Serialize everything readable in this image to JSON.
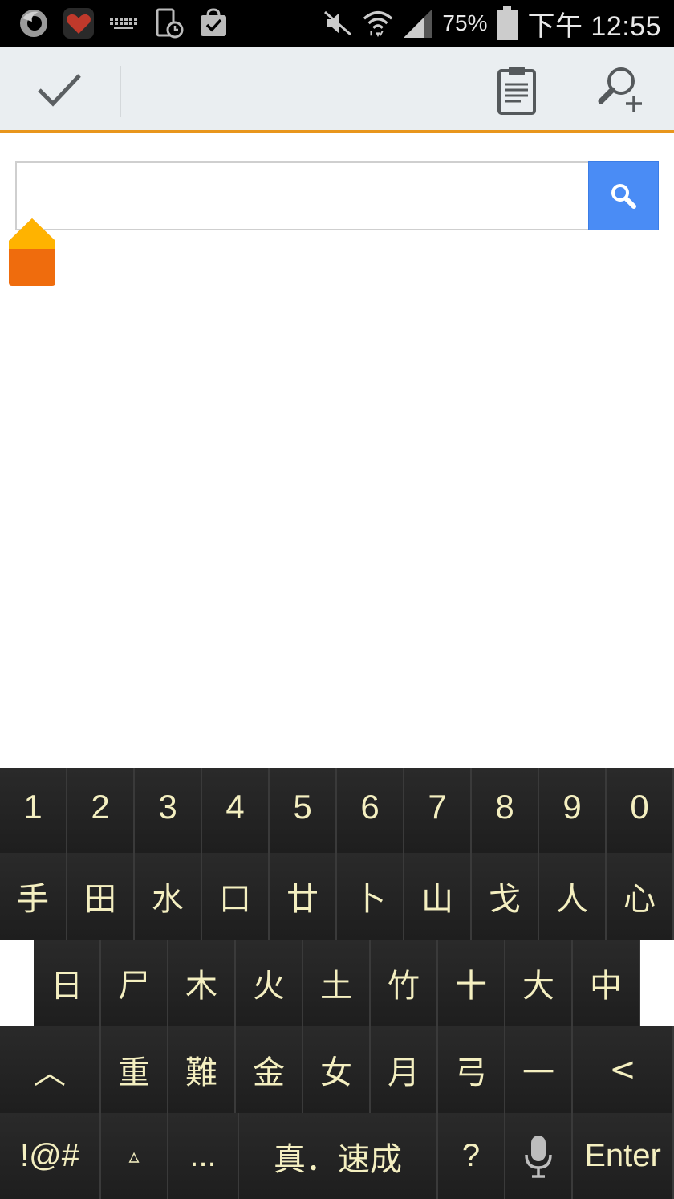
{
  "status_bar": {
    "battery_percent": "75%",
    "time": "下午 12:55",
    "icons": [
      "firefox-icon",
      "heart-app-icon",
      "keyboard-icon",
      "screen-time-icon",
      "shopping-bag-icon",
      "mute-icon",
      "wifi-icon",
      "signal-icon",
      "battery-icon"
    ]
  },
  "action_bar": {
    "icons": [
      "check-icon",
      "clipboard-icon",
      "zoom-add-icon"
    ],
    "accent_color": "#e8961c"
  },
  "search": {
    "value": "",
    "placeholder": "",
    "button_icon": "search-icon",
    "button_color": "#4a8cf5"
  },
  "keyboard": {
    "key_text_color": "#f4efc0",
    "numbers": [
      "1",
      "2",
      "3",
      "4",
      "5",
      "6",
      "7",
      "8",
      "9",
      "0"
    ],
    "row1": [
      "手",
      "田",
      "水",
      "口",
      "廿",
      "卜",
      "山",
      "戈",
      "人",
      "心"
    ],
    "row2": [
      "日",
      "尸",
      "木",
      "火",
      "土",
      "竹",
      "十",
      "大",
      "中"
    ],
    "row3": [
      "︿",
      "重",
      "難",
      "金",
      "女",
      "月",
      "弓",
      "一",
      "<"
    ],
    "bottom": {
      "symbols": "!@#",
      "triangle": "▵",
      "ellipsis": "...",
      "space": "真．速成",
      "question": "?",
      "mic_icon": "microphone-icon",
      "enter": "Enter"
    }
  }
}
